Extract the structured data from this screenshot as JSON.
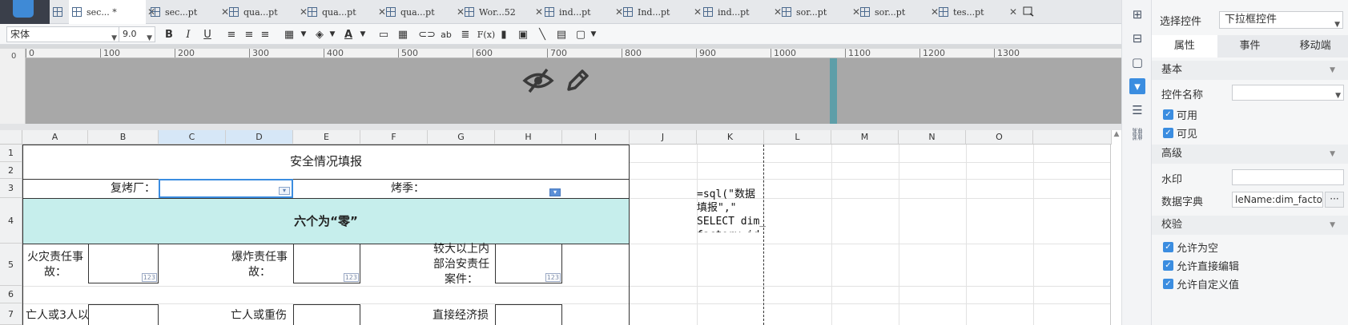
{
  "tabs": [
    {
      "label": "sec... *",
      "active": true
    },
    {
      "label": "sec...pt"
    },
    {
      "label": "qua...pt"
    },
    {
      "label": "qua...pt"
    },
    {
      "label": "qua...pt"
    },
    {
      "label": "Wor...52"
    },
    {
      "label": "ind...pt"
    },
    {
      "label": "Ind...pt"
    },
    {
      "label": "ind...pt"
    },
    {
      "label": "sor...pt"
    },
    {
      "label": "sor...pt"
    },
    {
      "label": "tes...pt"
    }
  ],
  "toolbar": {
    "font_family": "宋体",
    "font_size": "9.0",
    "fx_label": "F(x)"
  },
  "ruler": {
    "zero": "0",
    "ticks": [
      "0",
      "100",
      "200",
      "300",
      "400",
      "500",
      "600",
      "700",
      "800",
      "900",
      "1000",
      "1100",
      "1200",
      "1300"
    ]
  },
  "columns": [
    "A",
    "B",
    "C",
    "D",
    "E",
    "F",
    "G",
    "H",
    "I",
    "J",
    "K",
    "L",
    "M",
    "N",
    "O"
  ],
  "rows": [
    "1",
    "2",
    "3",
    "4",
    "5",
    "6",
    "7"
  ],
  "sheet": {
    "title": "安全情况填报",
    "label_factory": "复烤厂：",
    "label_season": "烤季：",
    "banner": "六个为“零”",
    "label_fire": "火灾责任事故：",
    "label_explosion": "爆炸责任事故：",
    "label_security": "较大以上内部治安责任案件：",
    "row7_a": "亡人或3人以",
    "row7_d": "亡人或重伤",
    "row7_g": "直接经济损",
    "num_badge": "123",
    "formula": "=sql(\"数据\n填报\",\"\nSELECT dim_\nfactory_id"
  },
  "panel": {
    "select_label": "选择控件",
    "select_value": "下拉框控件",
    "tabs": [
      "属性",
      "事件",
      "移动端"
    ],
    "section_basic": "基本",
    "widget_name_label": "控件名称",
    "widget_name_value": "",
    "enabled_label": "可用",
    "visible_label": "可见",
    "section_advanced": "高级",
    "watermark_label": "水印",
    "watermark_value": "",
    "dict_label": "数据字典",
    "dict_value": "leName:dim_factory]",
    "dots": "···",
    "section_validate": "校验",
    "allow_empty": "允许为空",
    "allow_direct_edit": "允许直接编辑",
    "allow_custom": "允许自定义值"
  },
  "colors": {
    "accent": "#3b8de0",
    "banner_bg": "#c6eeec",
    "canvas_bg": "#a8a8a8"
  }
}
